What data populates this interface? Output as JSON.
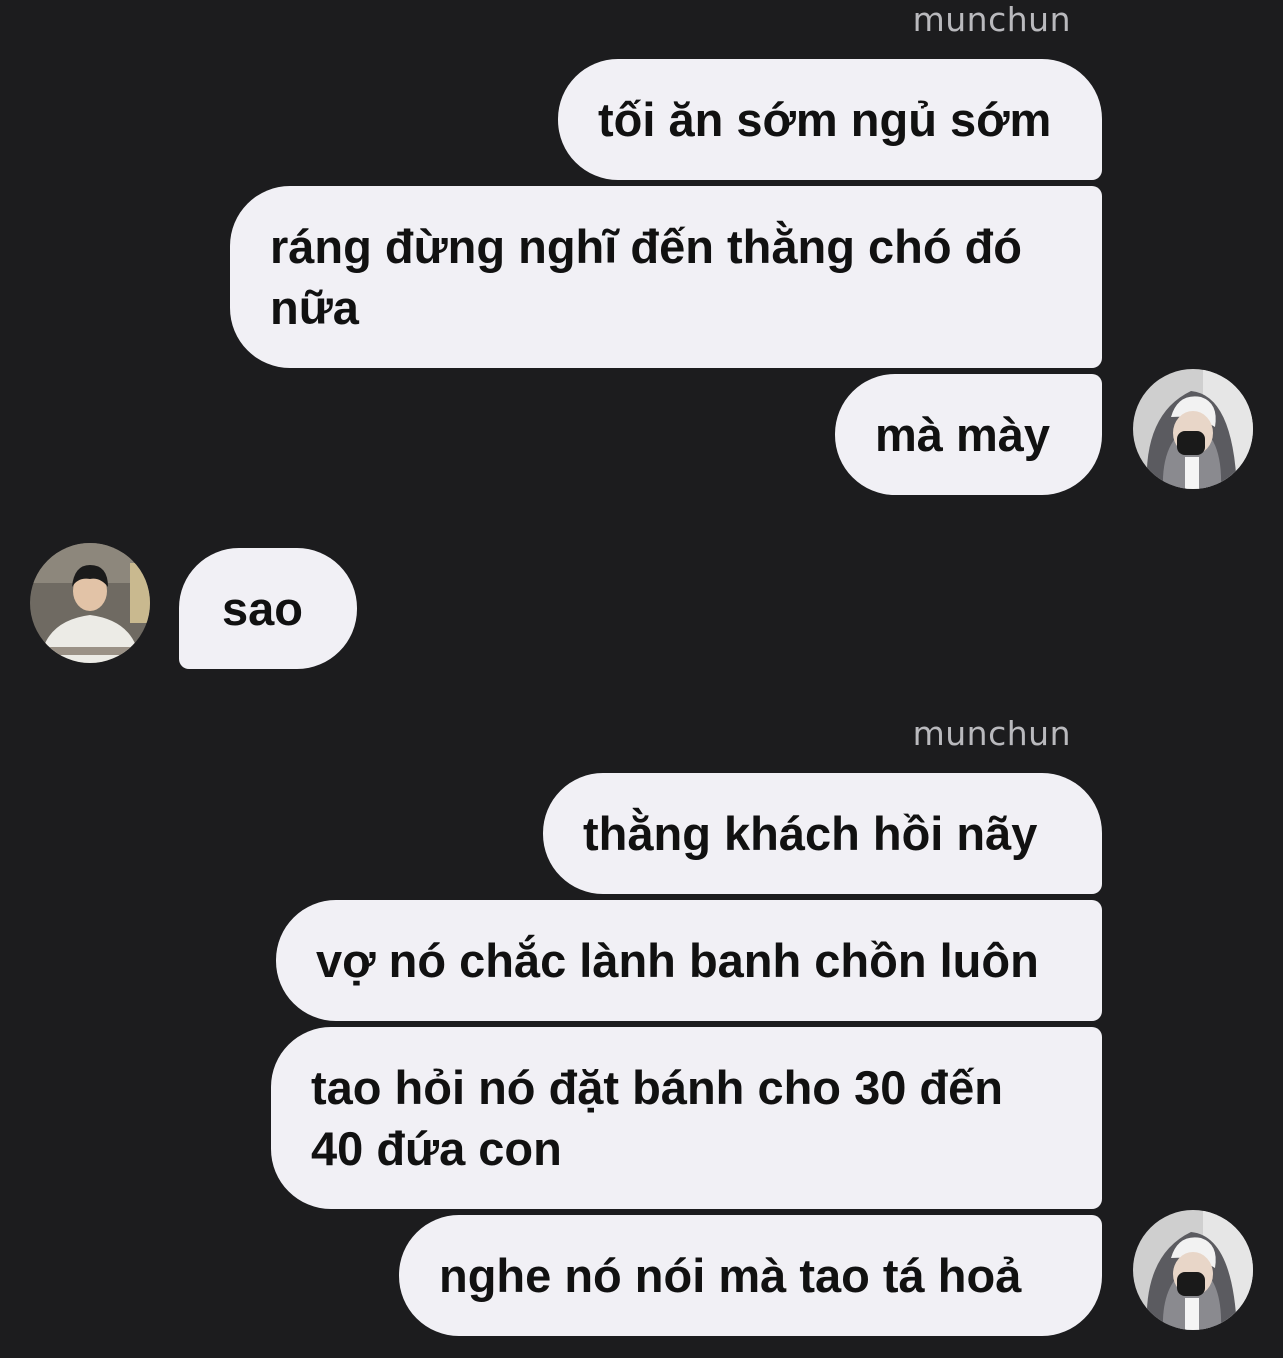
{
  "conversation": {
    "group1": {
      "sender": "munchun",
      "messages": [
        "tối ăn sớm ngủ sớm",
        "ráng đừng nghĩ đến thằng chó đó nữa",
        "mà mày"
      ]
    },
    "incoming": {
      "messages": [
        "sao"
      ]
    },
    "group2": {
      "sender": "munchun",
      "messages": [
        "thằng khách hồi nãy",
        "vợ nó chắc lành banh chồn luôn",
        "tao hỏi nó đặt bánh cho 30 đến 40 đứa con",
        "nghe nó nói mà tao tá hoả"
      ]
    }
  },
  "colors": {
    "background": "#1c1c1e",
    "bubble": "#f1f0f5",
    "sender_name": "#b9b9bd"
  },
  "icons": {
    "outgoing_avatar": "avatar-hooded-person",
    "incoming_avatar": "avatar-person-white-tshirt"
  }
}
